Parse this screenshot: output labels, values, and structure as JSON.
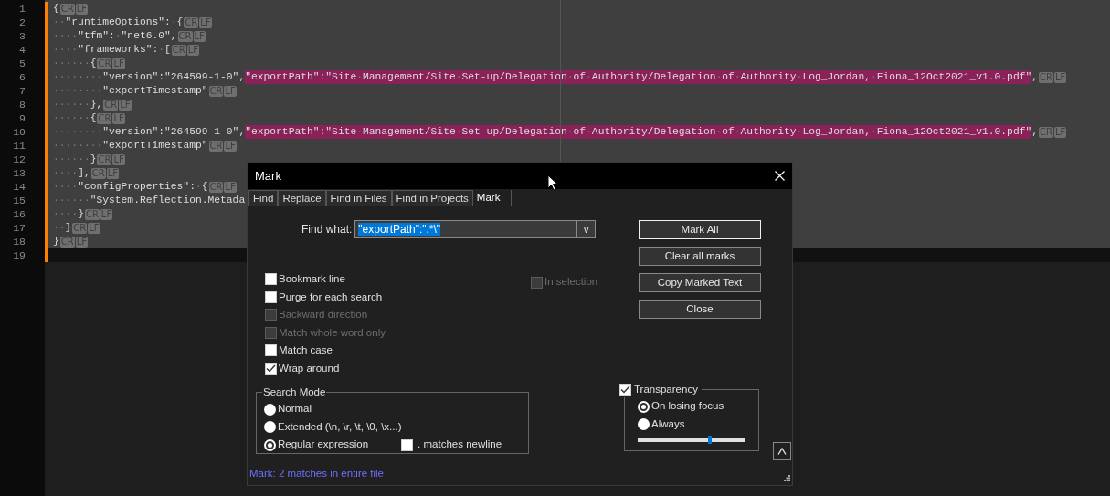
{
  "editor": {
    "lines": [
      {
        "number": "1",
        "changed": true,
        "current": false,
        "segments": [
          {
            "text": "{",
            "marked": false
          }
        ],
        "eol": [
          "CR",
          "LF"
        ]
      },
      {
        "number": "2",
        "changed": true,
        "current": false,
        "segments": [
          {
            "text": "··\"runtimeOptions\":·{",
            "marked": false
          }
        ],
        "eol": [
          "CR",
          "LF"
        ]
      },
      {
        "number": "3",
        "changed": true,
        "current": false,
        "segments": [
          {
            "text": "····\"tfm\":·\"net6.0\",",
            "marked": false
          }
        ],
        "eol": [
          "CR",
          "LF"
        ]
      },
      {
        "number": "4",
        "changed": true,
        "current": false,
        "segments": [
          {
            "text": "····\"frameworks\":·[",
            "marked": false
          }
        ],
        "eol": [
          "CR",
          "LF"
        ]
      },
      {
        "number": "5",
        "changed": true,
        "current": false,
        "segments": [
          {
            "text": "······{",
            "marked": false
          }
        ],
        "eol": [
          "CR",
          "LF"
        ]
      },
      {
        "number": "6",
        "changed": true,
        "current": false,
        "segments": [
          {
            "text": "········\"version\":\"264599-1-0\",",
            "marked": false
          },
          {
            "text": "\"exportPath\":\"Site·Management/Site·Set-up/Delegation·of·Authority/Delegation·of·Authority·Log_Jordan,·Fiona_12Oct2021_v1.0.pdf\"",
            "marked": true
          },
          {
            "text": ",",
            "marked": false
          }
        ],
        "eol": [
          "CR",
          "LF"
        ]
      },
      {
        "number": "7",
        "changed": true,
        "current": false,
        "segments": [
          {
            "text": "········\"exportTimestamp\"",
            "marked": false
          }
        ],
        "eol": [
          "CR",
          "LF"
        ]
      },
      {
        "number": "8",
        "changed": true,
        "current": false,
        "segments": [
          {
            "text": "······},",
            "marked": false
          }
        ],
        "eol": [
          "CR",
          "LF"
        ]
      },
      {
        "number": "9",
        "changed": true,
        "current": false,
        "segments": [
          {
            "text": "······{",
            "marked": false
          }
        ],
        "eol": [
          "CR",
          "LF"
        ]
      },
      {
        "number": "10",
        "changed": true,
        "current": false,
        "segments": [
          {
            "text": "········\"version\":\"264599-1-0\",",
            "marked": false
          },
          {
            "text": "\"exportPath\":\"Site·Management/Site·Set-up/Delegation·of·Authority/Delegation·of·Authority·Log_Jordan,·Fiona_12Oct2021_v1.0.pdf\"",
            "marked": true
          },
          {
            "text": ",",
            "marked": false
          }
        ],
        "eol": [
          "CR",
          "LF"
        ]
      },
      {
        "number": "11",
        "changed": true,
        "current": false,
        "segments": [
          {
            "text": "········\"exportTimestamp\"",
            "marked": false
          }
        ],
        "eol": [
          "CR",
          "LF"
        ]
      },
      {
        "number": "12",
        "changed": true,
        "current": false,
        "segments": [
          {
            "text": "······}",
            "marked": false
          }
        ],
        "eol": [
          "CR",
          "LF"
        ]
      },
      {
        "number": "13",
        "changed": true,
        "current": false,
        "segments": [
          {
            "text": "····],",
            "marked": false
          }
        ],
        "eol": [
          "CR",
          "LF"
        ]
      },
      {
        "number": "14",
        "changed": true,
        "current": false,
        "segments": [
          {
            "text": "····\"configProperties\":·{",
            "marked": false
          }
        ],
        "eol": [
          "CR",
          "LF"
        ]
      },
      {
        "number": "15",
        "changed": true,
        "current": false,
        "segments": [
          {
            "text": "······\"System.Reflection.Metada",
            "marked": false
          }
        ]
      },
      {
        "number": "16",
        "changed": true,
        "current": false,
        "segments": [
          {
            "text": "····}",
            "marked": false
          }
        ],
        "eol": [
          "CR",
          "LF"
        ]
      },
      {
        "number": "17",
        "changed": true,
        "current": false,
        "segments": [
          {
            "text": "··}",
            "marked": false
          }
        ],
        "eol": [
          "CR",
          "LF"
        ]
      },
      {
        "number": "18",
        "changed": true,
        "current": false,
        "segments": [
          {
            "text": "}",
            "marked": false
          }
        ],
        "eol": [
          "CR",
          "LF"
        ]
      },
      {
        "number": "19",
        "changed": true,
        "current": true
      }
    ]
  },
  "dialog": {
    "title": "Mark",
    "tabs": [
      {
        "label": "Find",
        "selected": false
      },
      {
        "label": "Replace",
        "selected": false
      },
      {
        "label": "Find in Files",
        "selected": false
      },
      {
        "label": "Find in Projects",
        "selected": false
      },
      {
        "label": "Mark",
        "selected": true
      }
    ],
    "find_what": {
      "label": "Find what:",
      "value": "\"exportPath\":\".*\\\"",
      "selected": true,
      "dropdown": "v"
    },
    "options": [
      {
        "label": "Bookmark line",
        "checked": false,
        "disabled": false
      },
      {
        "label": "Purge for each search",
        "checked": false,
        "disabled": false
      },
      {
        "label": "Backward direction",
        "checked": false,
        "disabled": true
      },
      {
        "label": "Match whole word only",
        "checked": false,
        "disabled": true
      },
      {
        "label": "Match case",
        "checked": false,
        "disabled": false
      },
      {
        "label": "Wrap around",
        "checked": true,
        "disabled": false
      }
    ],
    "in_selection": {
      "label": "In selection",
      "checked": false,
      "disabled": true
    },
    "search_mode": {
      "title": "Search Mode",
      "modes": [
        {
          "label": "Normal",
          "selected": false
        },
        {
          "label": "Extended (\\n, \\r, \\t, \\0, \\x...)",
          "selected": false
        },
        {
          "label": "Regular expression",
          "selected": true
        }
      ],
      "dot_matches_newline": {
        "label": ". matches newline",
        "checked": false
      }
    },
    "buttons": [
      {
        "label": "Mark All",
        "default": true
      },
      {
        "label": "Clear all marks",
        "default": false
      },
      {
        "label": "Copy Marked Text",
        "default": false
      },
      {
        "label": "Close",
        "default": false
      }
    ],
    "transparency": {
      "label": "Transparency",
      "checked": true,
      "modes": [
        {
          "label": "On losing focus",
          "selected": true
        },
        {
          "label": "Always",
          "selected": false
        }
      ],
      "level": 0.67
    },
    "status": "Mark: 2 matches in entire file"
  }
}
